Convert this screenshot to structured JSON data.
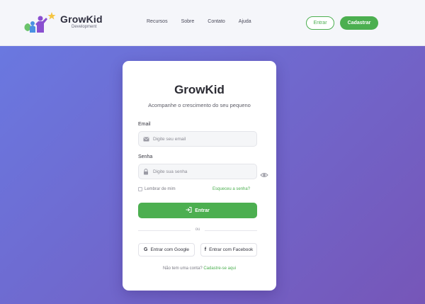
{
  "header": {
    "logo": {
      "name": "GrowKid",
      "sub": "Development"
    },
    "nav": [
      "Recursos",
      "Sobre",
      "Contato",
      "Ajuda"
    ],
    "login_label": "Entrar",
    "signup_label": "Cadastrar",
    "accent": "#4caf50"
  },
  "card": {
    "title": "GrowKid",
    "subtitle": "Acompanhe o crescimento do seu pequeno",
    "email_label": "Email",
    "email_placeholder": "Digite seu email",
    "password_label": "Senha",
    "password_placeholder": "Digite sua senha",
    "remember_label": "Lembrar de mim",
    "forgot_label": "Esqueceu a senha?",
    "enter_label": "Entrar",
    "or_label": "ou",
    "google_label": "Entrar com Google",
    "facebook_label": "Entrar com Facebook",
    "no_account_text": "Não tem uma conta?",
    "signup_link": "Cadastre-se aqui"
  },
  "icons": {
    "email": "envelope-icon",
    "password": "lock-icon",
    "toggle": "eye-icon",
    "enter": "login-arrow-icon",
    "google": "google-icon",
    "facebook": "facebook-icon"
  },
  "colors": {
    "hero_start": "#6a78e0",
    "hero_end": "#7656b8",
    "primary": "#4caf50"
  }
}
